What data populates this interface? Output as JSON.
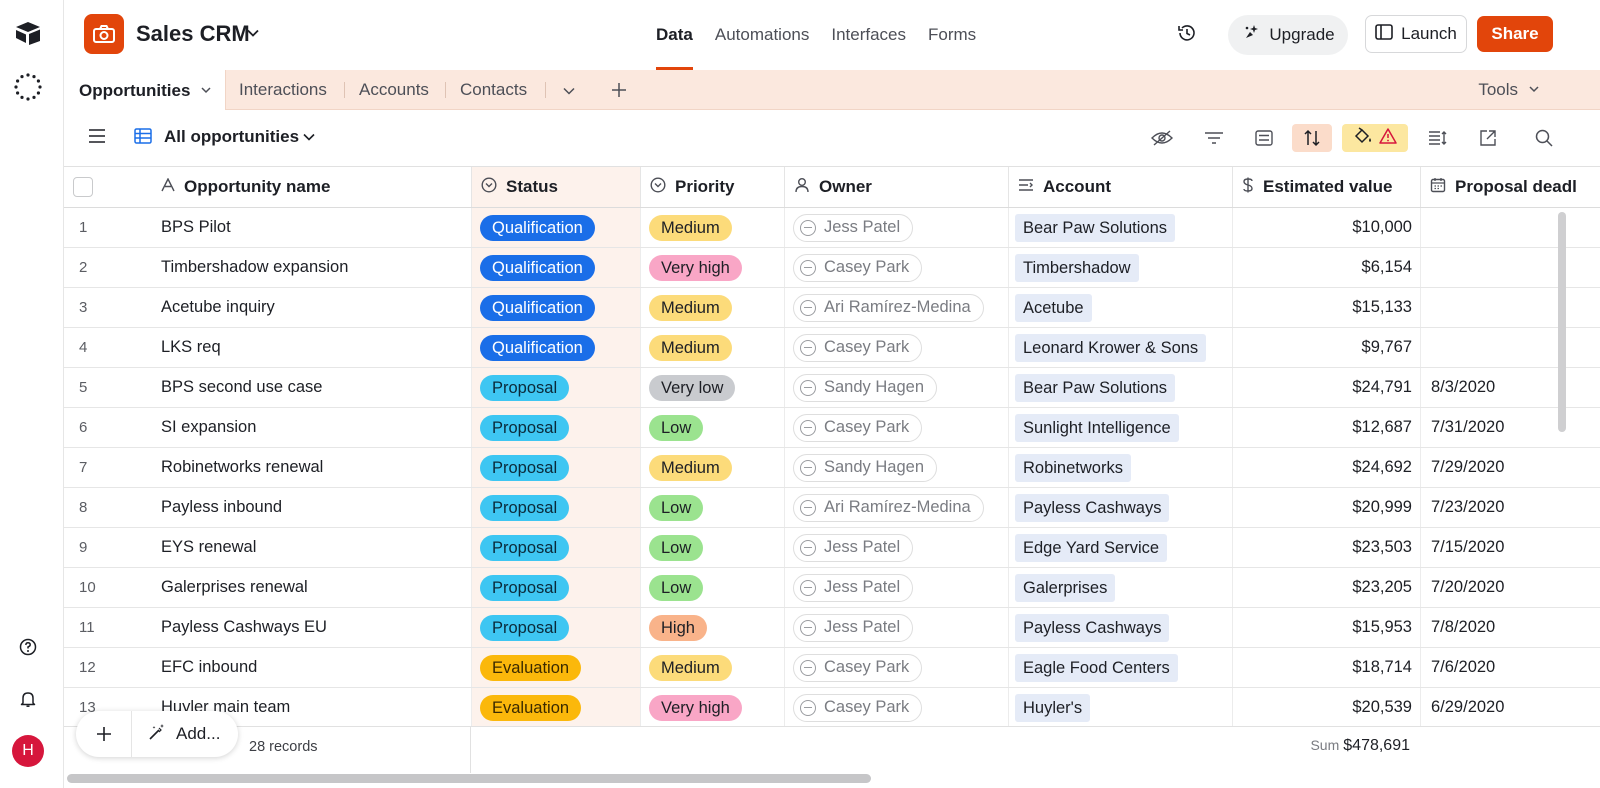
{
  "app": {
    "title": "Sales CRM",
    "nav": [
      "Data",
      "Automations",
      "Interfaces",
      "Forms"
    ],
    "active_nav": "Data",
    "upgrade_label": "Upgrade",
    "launch_label": "Launch",
    "share_label": "Share",
    "brand_color": "#e2450b"
  },
  "tables": {
    "active": "Opportunities",
    "others": [
      "Interactions",
      "Accounts",
      "Contacts"
    ],
    "tools_label": "Tools"
  },
  "view": {
    "name": "All opportunities"
  },
  "columns": [
    "Opportunity name",
    "Status",
    "Priority",
    "Owner",
    "Account",
    "Estimated value",
    "Proposal deadl"
  ],
  "rows": [
    {
      "num": "1",
      "name": "BPS Pilot",
      "status": "Qualification",
      "priority": "Medium",
      "owner": "Jess Patel",
      "account": "Bear Paw Solutions",
      "value": "$10,000",
      "deadline": ""
    },
    {
      "num": "2",
      "name": "Timbershadow expansion",
      "status": "Qualification",
      "priority": "Very high",
      "owner": "Casey Park",
      "account": "Timbershadow",
      "value": "$6,154",
      "deadline": ""
    },
    {
      "num": "3",
      "name": "Acetube inquiry",
      "status": "Qualification",
      "priority": "Medium",
      "owner": "Ari Ramírez-Medina",
      "account": "Acetube",
      "value": "$15,133",
      "deadline": ""
    },
    {
      "num": "4",
      "name": "LKS req",
      "status": "Qualification",
      "priority": "Medium",
      "owner": "Casey Park",
      "account": "Leonard Krower & Sons",
      "value": "$9,767",
      "deadline": ""
    },
    {
      "num": "5",
      "name": "BPS second use case",
      "status": "Proposal",
      "priority": "Very low",
      "owner": "Sandy Hagen",
      "account": "Bear Paw Solutions",
      "value": "$24,791",
      "deadline": "8/3/2020"
    },
    {
      "num": "6",
      "name": "SI expansion",
      "status": "Proposal",
      "priority": "Low",
      "owner": "Casey Park",
      "account": "Sunlight Intelligence",
      "value": "$12,687",
      "deadline": "7/31/2020"
    },
    {
      "num": "7",
      "name": "Robinetworks renewal",
      "status": "Proposal",
      "priority": "Medium",
      "owner": "Sandy Hagen",
      "account": "Robinetworks",
      "value": "$24,692",
      "deadline": "7/29/2020"
    },
    {
      "num": "8",
      "name": "Payless inbound",
      "status": "Proposal",
      "priority": "Low",
      "owner": "Ari Ramírez-Medina",
      "account": "Payless Cashways",
      "value": "$20,999",
      "deadline": "7/23/2020"
    },
    {
      "num": "9",
      "name": "EYS renewal",
      "status": "Proposal",
      "priority": "Low",
      "owner": "Jess Patel",
      "account": "Edge Yard Service",
      "value": "$23,503",
      "deadline": "7/15/2020"
    },
    {
      "num": "10",
      "name": "Galerprises renewal",
      "status": "Proposal",
      "priority": "Low",
      "owner": "Jess Patel",
      "account": "Galerprises",
      "value": "$23,205",
      "deadline": "7/20/2020"
    },
    {
      "num": "11",
      "name": "Payless Cashways EU",
      "status": "Proposal",
      "priority": "High",
      "owner": "Jess Patel",
      "account": "Payless Cashways",
      "value": "$15,953",
      "deadline": "7/8/2020"
    },
    {
      "num": "12",
      "name": "EFC inbound",
      "status": "Evaluation",
      "priority": "Medium",
      "owner": "Casey Park",
      "account": "Eagle Food Centers",
      "value": "$18,714",
      "deadline": "7/6/2020"
    },
    {
      "num": "13",
      "name": "Huyler main team",
      "status": "Evaluation",
      "priority": "Very high",
      "owner": "Casey Park",
      "account": "Huyler's",
      "value": "$20,539",
      "deadline": "6/29/2020"
    }
  ],
  "status_colors": {
    "Qualification": {
      "bg": "#1a6ee8",
      "fg": "#ffffff"
    },
    "Proposal": {
      "bg": "#3ec6f2",
      "fg": "#0b2a3a"
    },
    "Evaluation": {
      "bg": "#fbb80b",
      "fg": "#3a2a00"
    }
  },
  "priority_colors": {
    "Medium": "#fcdb7a",
    "Very high": "#f9a6c6",
    "Very low": "#c9cbcf",
    "Low": "#9be38f",
    "High": "#f9b38a"
  },
  "footer": {
    "add_label": "Add...",
    "records": "28 records",
    "sum_label": "Sum",
    "sum_value": "$478,691"
  }
}
